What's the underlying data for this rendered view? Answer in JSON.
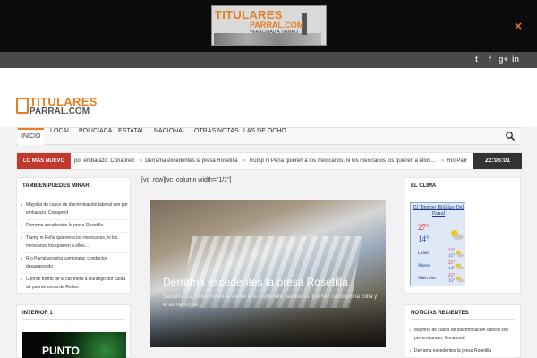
{
  "ad": {
    "logo_top": "TITULARES",
    "logo_sub": "PARRAL.COM",
    "slogan": "VERACIDAD A TIEMPO",
    "close": "×"
  },
  "social": {
    "twitter": "t",
    "facebook": "f",
    "google": "g+",
    "linkedin": "in"
  },
  "header": {
    "logo_top": "TITULARES",
    "logo_sub": "PARRAL.COM"
  },
  "nav": {
    "items": [
      "INICIO",
      "LOCAL",
      "POLICIACA",
      "ESTATAL",
      "NACIONAL",
      "OTRAS NOTAS",
      "LAS DE OCHO"
    ]
  },
  "ticker": {
    "label": "LO MÁS NUEVO",
    "items": [
      "por embarazo: Conapred",
      "Derrama excedentes la presa Rosetilla",
      "Trump ni Peña quieren a los mexicanos, ni los mexicanos los quieren a ellos…",
      "Río Parr"
    ],
    "clock": "22:05:01"
  },
  "left_panel": {
    "title": "TAMBIEN PUEDES MIRAR",
    "items": [
      "Mayoría de casos de discriminación laboral son por embarazo: Conapred",
      "Derrama excedentes la presa Rosetilla",
      "Trump ni Peña quieren a los mexicanos, ni los mexicanos los quieren a ellos…",
      "Río Parral arrastra camioneta; conductor desaparecido",
      "Cierran tramo de la carretera a Durango por caída de puente cerca de Rodeo"
    ]
  },
  "left_panel2": {
    "title": "INTERIOR 1",
    "image_text": "PUNTO"
  },
  "main": {
    "shortcode": "[vc_row][vc_column width=\"1/1\"]",
    "slide_title": "Derrama excedentes la presa Rosetilla",
    "slide_excerpt": "Saucillo.- La presa Rosetilla vuelve a su esplendor, las lluvias que han caído por la zona y el  aumento del…"
  },
  "right_panel": {
    "title": "EL CLIMA",
    "weather_title": "El Tiempo Hidalgo Del Parral",
    "temp_high": "27°",
    "temp_low": "14°",
    "days": [
      {
        "name": "Lunes",
        "high": "23°",
        "low": "15°"
      },
      {
        "name": "Martes",
        "high": "25°",
        "low": "14°"
      },
      {
        "name": "Miércoles",
        "high": "25°",
        "low": "15°"
      }
    ]
  },
  "recent_panel": {
    "title": "NOTICIAS RECIENTES",
    "items": [
      "Mayoría de casos de discriminación laboral son por embarazo: Conapred",
      "Derrama excedentes la presa Rosetilla"
    ]
  },
  "colors": {
    "accent": "#e67e22",
    "ticker_red": "#c0392b"
  }
}
